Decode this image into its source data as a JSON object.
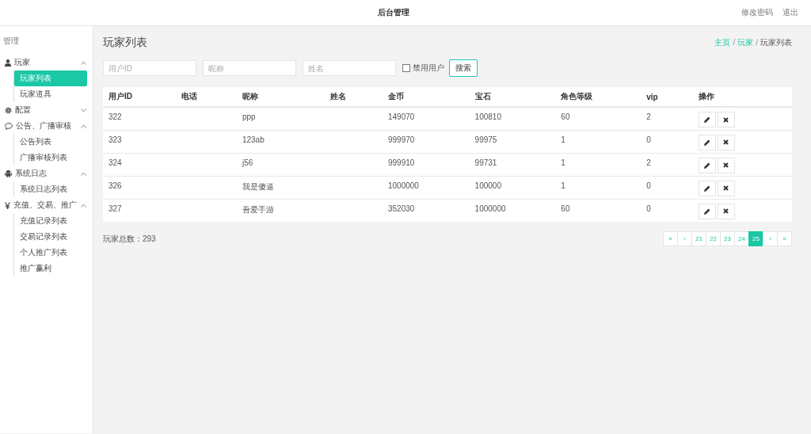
{
  "header": {
    "title": "后台管理",
    "links": [
      "修改密码",
      "退出"
    ]
  },
  "sidebar": {
    "heading": "管理",
    "groups": [
      {
        "kind": "user",
        "label": "玩家",
        "expanded": true,
        "items": [
          {
            "label": "玩家列表",
            "selected": true
          },
          {
            "label": "玩家道具",
            "selected": false
          }
        ]
      },
      {
        "kind": "gear",
        "label": "配置",
        "expanded": false
      },
      {
        "kind": "chat",
        "label": "公告、广播审核",
        "expanded": true,
        "items": [
          {
            "label": "公告列表",
            "selected": false
          },
          {
            "label": "广播审核列表",
            "selected": false
          }
        ]
      },
      {
        "kind": "android",
        "label": "系统日志",
        "expanded": true,
        "items": [
          {
            "label": "系统日志列表",
            "selected": false
          }
        ]
      },
      {
        "kind": "yen",
        "label": "充值、交易、推广",
        "expanded": true,
        "items": [
          {
            "label": "充值记录列表",
            "selected": false
          },
          {
            "label": "交易记录列表",
            "selected": false
          },
          {
            "label": "个人推广列表",
            "selected": false
          },
          {
            "label": "推广赢利",
            "selected": false
          }
        ]
      }
    ]
  },
  "page": {
    "title": "玩家列表",
    "breadcrumb_separator": "/",
    "breadcrumb": [
      {
        "label": "主页",
        "link": true
      },
      {
        "label": "玩家",
        "link": true
      },
      {
        "label": "玩家列表",
        "link": false
      }
    ]
  },
  "filters": {
    "fields": [
      {
        "placeholder": "用户ID"
      },
      {
        "placeholder": "昵称"
      },
      {
        "placeholder": "姓名"
      }
    ],
    "checkbox": {
      "label": "禁用用户",
      "checked": false
    },
    "button": "搜索"
  },
  "table": {
    "columns": [
      "用户ID",
      "电话",
      "昵称",
      "姓名",
      "金币",
      "宝石",
      "角色等级",
      "vip",
      "操作"
    ],
    "rows": [
      {
        "cells": [
          "322",
          null,
          "ppp",
          null,
          "149070",
          "100810",
          "60",
          "2"
        ]
      },
      {
        "cells": [
          "323",
          null,
          "123ab",
          null,
          "999970",
          "99975",
          "1",
          "0"
        ]
      },
      {
        "cells": [
          "324",
          null,
          "j56",
          null,
          "999910",
          "99731",
          "1",
          "2"
        ]
      },
      {
        "cells": [
          "326",
          null,
          "我是傻逼",
          null,
          "1000000",
          "100000",
          "1",
          "0"
        ]
      },
      {
        "cells": [
          "327",
          null,
          "吾爱手游",
          null,
          "352030",
          "1000000",
          "60",
          "0"
        ]
      }
    ]
  },
  "summary": "玩家总数：293",
  "pagination": [
    {
      "label": "«",
      "selected": false
    },
    {
      "label": "‹",
      "selected": false
    },
    {
      "label": "21",
      "selected": false
    },
    {
      "label": "22",
      "selected": false
    },
    {
      "label": "23",
      "selected": false
    },
    {
      "label": "24",
      "selected": false
    },
    {
      "label": "25",
      "selected": true
    },
    {
      "label": "›",
      "selected": false
    },
    {
      "label": "»",
      "selected": false
    }
  ]
}
